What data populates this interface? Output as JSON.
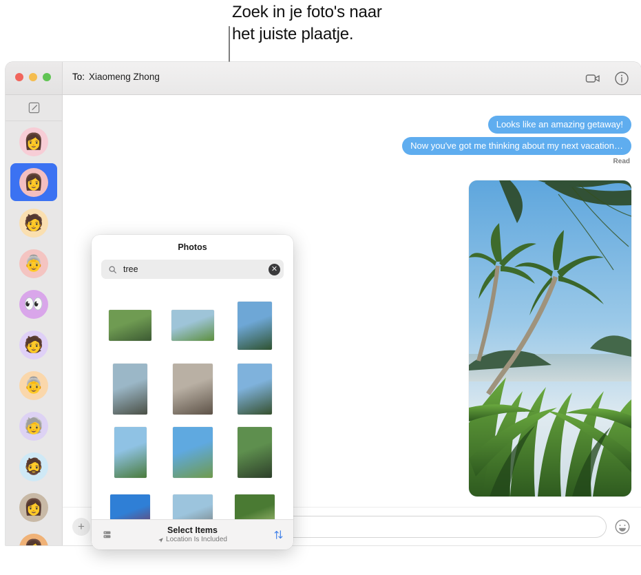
{
  "callout": {
    "text": "Zoek in je foto's naar\nhet juiste plaatje."
  },
  "window": {
    "to_label": "To:",
    "to_name": "Xiaomeng Zhong",
    "traffic_lights": [
      "close",
      "minimize",
      "zoom"
    ],
    "actions": [
      {
        "name": "facetime-video-icon",
        "label": "FaceTime video"
      },
      {
        "name": "details-info-icon",
        "label": "Details"
      }
    ]
  },
  "sidebar": {
    "compose_label": "New Message",
    "conversations": [
      {
        "name": "conversation-avatar-1",
        "glyph": "👩",
        "bg": "#f7cdd6",
        "selected": false
      },
      {
        "name": "conversation-avatar-2",
        "glyph": "👩",
        "bg": "#f3bfc0",
        "selected": true
      },
      {
        "name": "conversation-avatar-3",
        "glyph": "🧑",
        "bg": "#fadfb0",
        "selected": false
      },
      {
        "name": "conversation-avatar-4",
        "glyph": "👵",
        "bg": "#f4c4c1",
        "selected": false
      },
      {
        "name": "conversation-avatar-5",
        "glyph": "👀",
        "bg": "#d9a6ea",
        "selected": false
      },
      {
        "name": "conversation-avatar-6",
        "glyph": "🧑",
        "bg": "#dfd0f7",
        "selected": false
      },
      {
        "name": "conversation-avatar-7",
        "glyph": "👵",
        "bg": "#fad7ab",
        "selected": false
      },
      {
        "name": "conversation-avatar-8",
        "glyph": "🧓",
        "bg": "#ddd2f4",
        "selected": false
      },
      {
        "name": "conversation-avatar-9",
        "glyph": "🧔",
        "bg": "#cfe9f6",
        "selected": false
      },
      {
        "name": "conversation-avatar-10",
        "glyph": "👩",
        "bg": "#c8b9a6",
        "selected": false
      },
      {
        "name": "conversation-avatar-11",
        "glyph": "👩",
        "bg": "#f0b277",
        "selected": false
      }
    ]
  },
  "conversation": {
    "messages": [
      {
        "text": "Looks like an amazing getaway!",
        "from": "me"
      },
      {
        "text": "Now you've got me thinking about my next vacation…",
        "from": "me"
      }
    ],
    "status": "Read",
    "attachment": {
      "name": "tropical-beach-palm-photo",
      "description": "Palm trees over a tropical beach with green foliage"
    }
  },
  "composer": {
    "add_label": "+",
    "input_value": "",
    "input_placeholder": "",
    "emoji_label": "Emoji"
  },
  "photos_panel": {
    "title": "Photos",
    "search": {
      "value": "tree",
      "placeholder": "Search",
      "clear_label": "✕"
    },
    "footer": {
      "select_items": "Select Items",
      "location_note": "Location Is Included"
    },
    "grid": [
      [
        {
          "name": "photo-forest-rocks",
          "w": 62,
          "h": 45,
          "c1": "#6f9b52",
          "c2": "#3c5a33"
        },
        {
          "name": "photo-green-meadow",
          "w": 62,
          "h": 45,
          "c1": "#9ec4d8",
          "c2": "#5c8f3d"
        },
        {
          "name": "photo-palm-river",
          "w": 50,
          "h": 70,
          "c1": "#6ea7d6",
          "c2": "#2f5230"
        }
      ],
      [
        {
          "name": "photo-coastal-cliffs",
          "w": 50,
          "h": 74,
          "c1": "#9bb7c7",
          "c2": "#4a4f45"
        },
        {
          "name": "photo-sea-stacks",
          "w": 58,
          "h": 74,
          "c1": "#b9b0a4",
          "c2": "#5d5247"
        },
        {
          "name": "photo-jungle-stream",
          "w": 50,
          "h": 74,
          "c1": "#7fb2dc",
          "c2": "#36502e"
        }
      ],
      [
        {
          "name": "photo-palms-sky",
          "w": 47,
          "h": 74,
          "c1": "#8fc2e4",
          "c2": "#4a7b3b"
        },
        {
          "name": "photo-dog-in-flowers",
          "w": 58,
          "h": 74,
          "c1": "#5fa9e0",
          "c2": "#6f9a4c"
        },
        {
          "name": "photo-palm-path",
          "w": 50,
          "h": 74,
          "c1": "#5e8f4e",
          "c2": "#2d3f2a"
        }
      ],
      [
        {
          "name": "photo-red-leaves-sky",
          "w": 58,
          "h": 62,
          "c1": "#2f7fd6",
          "c2": "#8a2438"
        },
        {
          "name": "photo-beach-shore",
          "w": 58,
          "h": 62,
          "c1": "#9cc4dd",
          "c2": "#6b675f"
        },
        {
          "name": "photo-white-blossom",
          "w": 58,
          "h": 62,
          "c1": "#4a7a33",
          "c2": "#c8d98f"
        }
      ]
    ]
  },
  "colors": {
    "bubble_blue": "#5fadef",
    "selection_blue": "#3b72f2",
    "accent_blue": "#3f7fe8"
  }
}
